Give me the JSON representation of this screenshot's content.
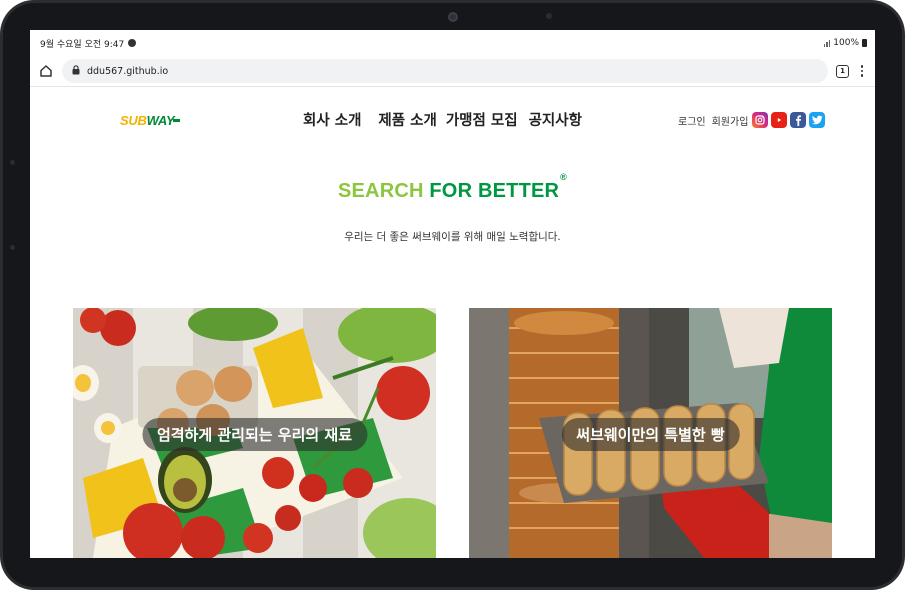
{
  "status_bar": {
    "time": "9월 수요일 오전 9:47",
    "battery": "100%"
  },
  "browser": {
    "url": "ddu567.github.io",
    "tab_count": "1"
  },
  "site": {
    "logo": {
      "part1": "SUB",
      "part2": "WAY"
    },
    "nav": [
      "회사 소개",
      "제품 소개",
      "가맹점 모집",
      "공지사항"
    ],
    "login": "로그인",
    "signup": "회원가입",
    "social": [
      "instagram-icon",
      "youtube-icon",
      "facebook-icon",
      "twitter-icon"
    ],
    "hero": {
      "title_part1": "SEARCH",
      "title_part2": "FOR BETTER",
      "trademark": "®",
      "subtitle": "우리는 더 좋은 써브웨이를 위해 매일 노력합니다."
    },
    "cards": [
      {
        "caption": "엄격하게 관리되는 우리의 재료"
      },
      {
        "caption": "써브웨이만의 특별한 빵"
      }
    ]
  },
  "colors": {
    "logo_yellow": "#f2b200",
    "brand_green": "#009743",
    "light_green": "#8cc63f"
  }
}
